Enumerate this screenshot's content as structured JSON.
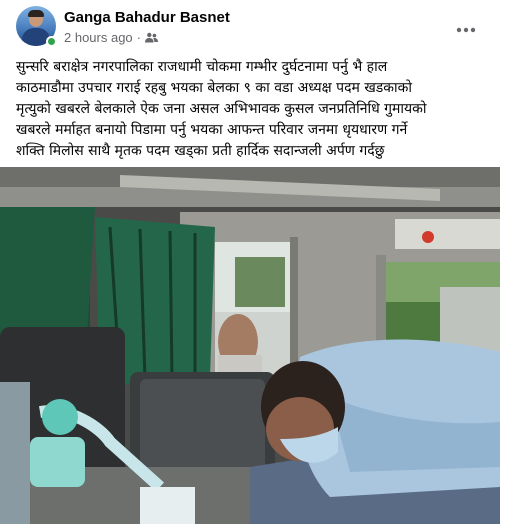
{
  "post": {
    "author_name": "Ganga Bahadur Basnet",
    "timestamp": "2 hours ago",
    "separator": "·",
    "privacy_icon": "friends-icon",
    "more_icon": "more-horizontal-icon",
    "text_lines": [
      "सुन्सरि बराक्षेत्र नगरपालिका राजधामी चोकमा गम्भीर दुर्घटनामा पर्नु भै हाल",
      "काठमाडौमा उपचार गराई रहबु भयका बेलका ९ का वडा अध्यक्ष पदम खडकाको",
      "मृत्युको खबरले बेलकाले ऐक जना असल अभिभावक कुसल जनप्रतिनिधि गुमायको",
      "खबरले मर्माहत बनायो  पिडामा पर्नु भयका आफन्त परिवार जनमा धृयधारण गर्ने",
      "शक्ति मिलोस साथै मृतक पदम खड्का प्रती हार्दिक सदान्जली अर्पण गर्दछु"
    ]
  },
  "colors": {
    "name": "#050505",
    "meta": "#65676b",
    "online": "#31a24c",
    "curtain": "#1f5a3f",
    "shirt": "#a9c6de"
  }
}
